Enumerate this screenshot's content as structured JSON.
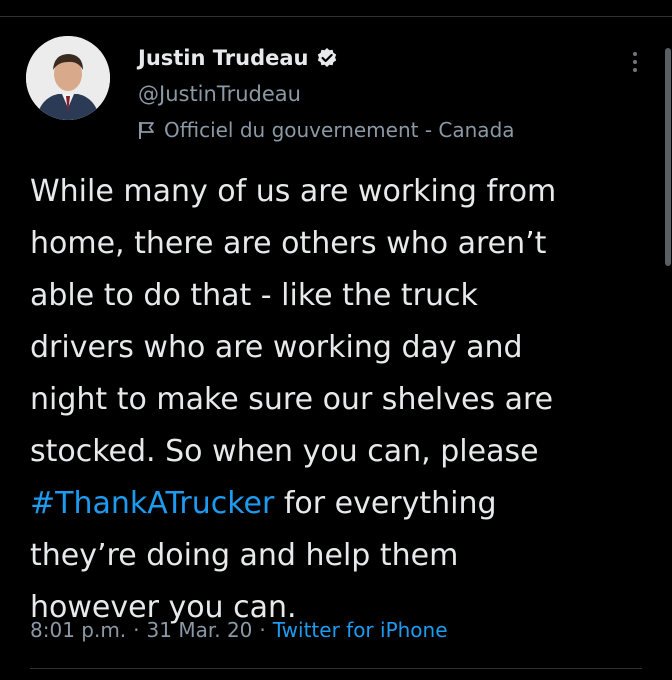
{
  "tweet": {
    "author": {
      "name": "Justin Trudeau",
      "handle": "@JustinTrudeau",
      "label": "Officiel du gouvernement - Canada",
      "verified": true,
      "avatar_icon": "profile-photo"
    },
    "text_lines": [
      "While many of us are working from",
      "home, there are others who aren’t",
      "able to do that - like the truck",
      "drivers who are working day and",
      "night to make sure our shelves are",
      "stocked. So when you can, please"
    ],
    "hashtag": "#ThankATrucker",
    "line7_rest": " for everything",
    "text_lines_end": [
      "they’re doing and help them",
      "however you can."
    ],
    "time": "8:01 p.m.",
    "separator": "·",
    "date": "31 Mar. 20",
    "source": "Twitter for iPhone"
  },
  "colors": {
    "background": "#000000",
    "text": "#e7e9ea",
    "secondary": "#8b98a5",
    "link": "#1d9bf0"
  },
  "icons": [
    "verified-badge-icon",
    "government-flag-icon",
    "more-options-icon"
  ]
}
